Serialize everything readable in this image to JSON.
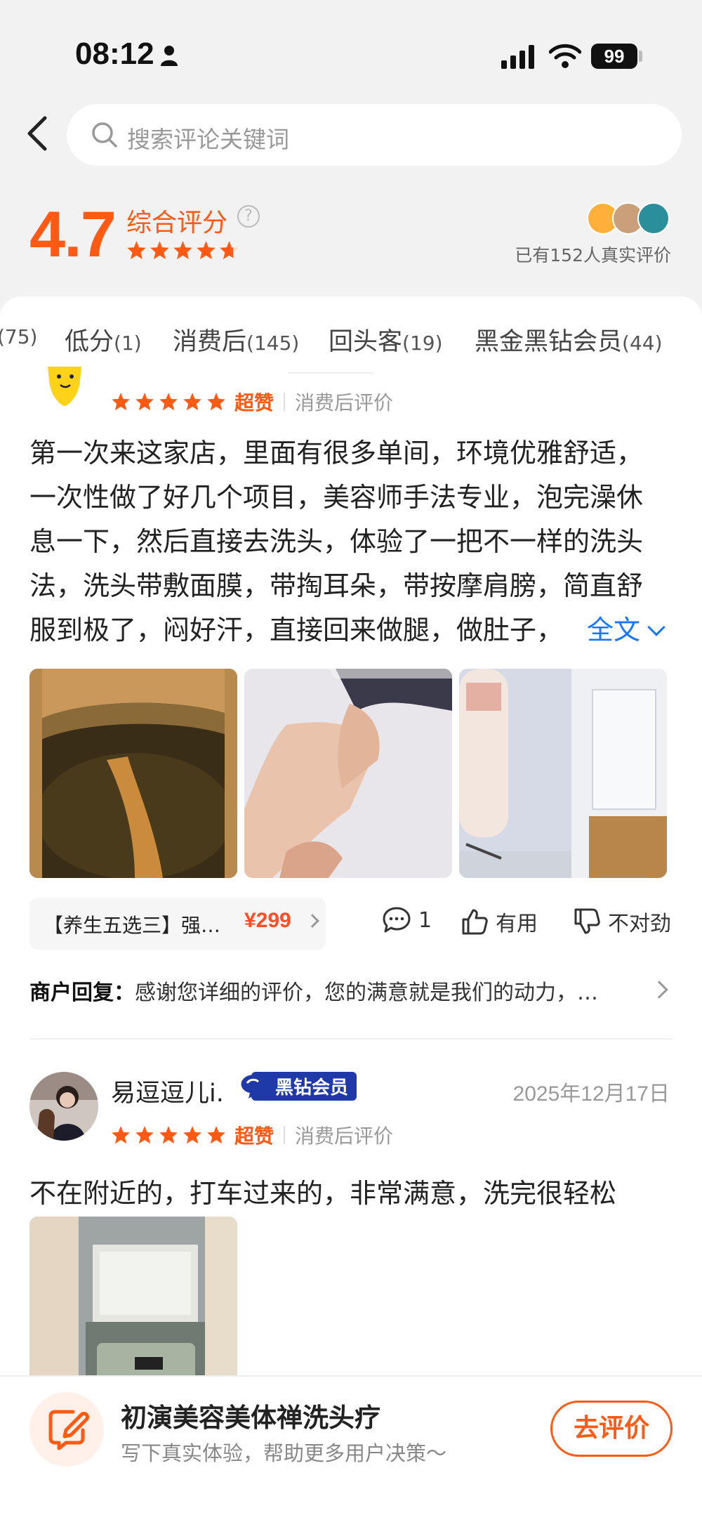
{
  "status_bar": {
    "time": "08:12",
    "battery": "99"
  },
  "search": {
    "placeholder": "搜索评论关键词"
  },
  "rating": {
    "score": "4.7",
    "label": "综合评分",
    "help": "?",
    "stars_value": 4.7,
    "stars_max": 5,
    "real_count_text": "已有152人真实评价"
  },
  "tabs": [
    {
      "label": "",
      "count": "(75)"
    },
    {
      "label": "低分",
      "count": "(1)"
    },
    {
      "label": "消费后",
      "count": "(145)"
    },
    {
      "label": "回头客",
      "count": "(19)"
    },
    {
      "label": "黑金黑钻会员",
      "count": "(44)"
    }
  ],
  "review1": {
    "stars": 5,
    "tag": "超赞",
    "type": "消费后评价",
    "lines": [
      "第一次来这家店，里面有很多单间，环境优雅舒适，",
      "一次性做了好几个项目，美容师手法专业，泡完澡休",
      "息一下，然后直接去洗头，体验了一把不一样的洗头",
      "法，洗头带敷面膜，带掏耳朵，带按摩肩膀，简直舒",
      "服到极了，闷好汗，直接回来做腿，做肚子，"
    ],
    "full_text": "全文",
    "deal_name": "【养生五选三】强…",
    "deal_price": "¥299",
    "comments": "1",
    "useful": "有用",
    "not_right": "不对劲",
    "reply_label": "商户回复：",
    "reply_text": "感谢您详细的评价，您的满意就是我们的动力，…"
  },
  "review2": {
    "name": "易逗逗儿i.",
    "badge": "黑钻会员",
    "date": "2025年12月17日",
    "stars": 5,
    "tag": "超赞",
    "type": "消费后评价",
    "text": "不在附近的，打车过来的，非常满意，洗完很轻松"
  },
  "bottom_bar": {
    "title": "初演美容美体禅洗头疗",
    "subtitle": "写下真实体验，帮助更多用户决策～",
    "button": "去评价"
  },
  "colors": {
    "accent": "#ff5a14",
    "link": "#1677ff",
    "badge": "#1f3aa8"
  }
}
